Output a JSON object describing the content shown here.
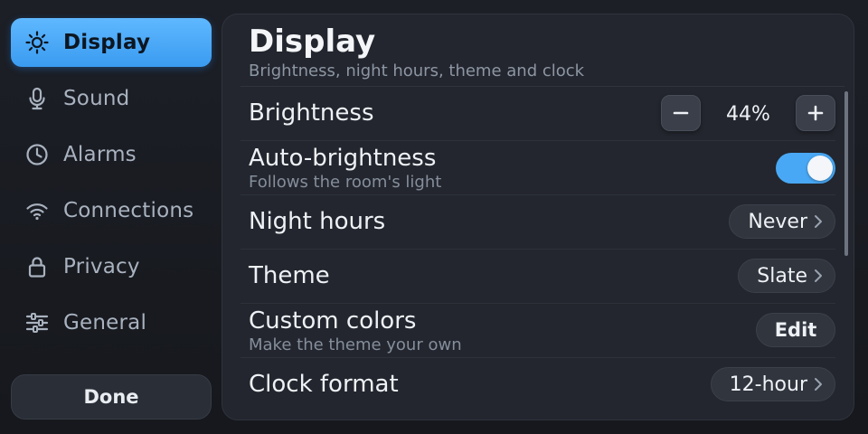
{
  "sidebar": {
    "items": [
      {
        "label": "Display",
        "icon": "sun-icon",
        "active": true
      },
      {
        "label": "Sound",
        "icon": "microphone-icon",
        "active": false
      },
      {
        "label": "Alarms",
        "icon": "clock-icon",
        "active": false
      },
      {
        "label": "Connections",
        "icon": "wifi-icon",
        "active": false
      },
      {
        "label": "Privacy",
        "icon": "lock-icon",
        "active": false
      },
      {
        "label": "General",
        "icon": "sliders-icon",
        "active": false
      }
    ],
    "done_label": "Done"
  },
  "panel": {
    "title": "Display",
    "subtitle": "Brightness, night hours, theme and clock",
    "settings": {
      "brightness": {
        "label": "Brightness",
        "value": "44%"
      },
      "auto_brightness": {
        "label": "Auto-brightness",
        "sublabel": "Follows the room's light",
        "enabled": true
      },
      "night_hours": {
        "label": "Night hours",
        "value": "Never"
      },
      "theme": {
        "label": "Theme",
        "value": "Slate"
      },
      "custom_colors": {
        "label": "Custom colors",
        "sublabel": "Make the theme your own",
        "button_label": "Edit"
      },
      "clock_format": {
        "label": "Clock format",
        "value": "12-hour"
      }
    }
  },
  "colors": {
    "accent": "#4aa9f5",
    "background": "#191c22",
    "panel": "#23262e"
  }
}
